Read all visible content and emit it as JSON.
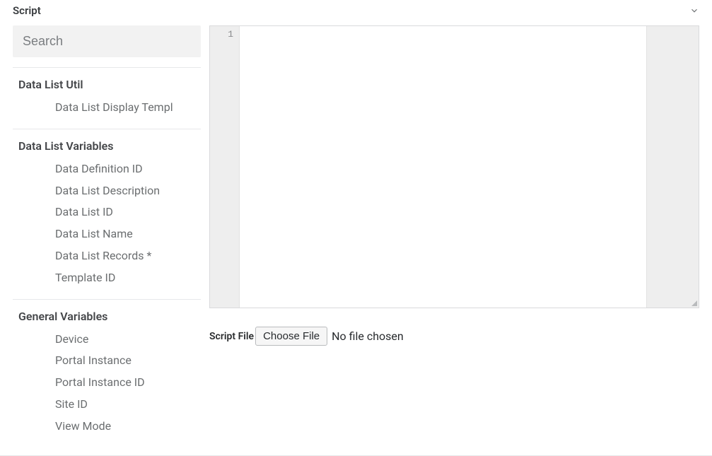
{
  "panel": {
    "title": "Script"
  },
  "search": {
    "placeholder": "Search",
    "value": ""
  },
  "sidebar": {
    "groups": [
      {
        "label": "Data List Util",
        "items": [
          "Data List Display Templ"
        ]
      },
      {
        "label": "Data List Variables",
        "items": [
          "Data Definition ID",
          "Data List Description",
          "Data List ID",
          "Data List Name",
          "Data List Records *",
          "Template ID"
        ]
      },
      {
        "label": "General Variables",
        "items": [
          "Device",
          "Portal Instance",
          "Portal Instance ID",
          "Site ID",
          "View Mode"
        ]
      }
    ]
  },
  "editor": {
    "line_number": "1",
    "content": ""
  },
  "script_file": {
    "label": "Script File",
    "button": "Choose File",
    "status": "No file chosen"
  }
}
